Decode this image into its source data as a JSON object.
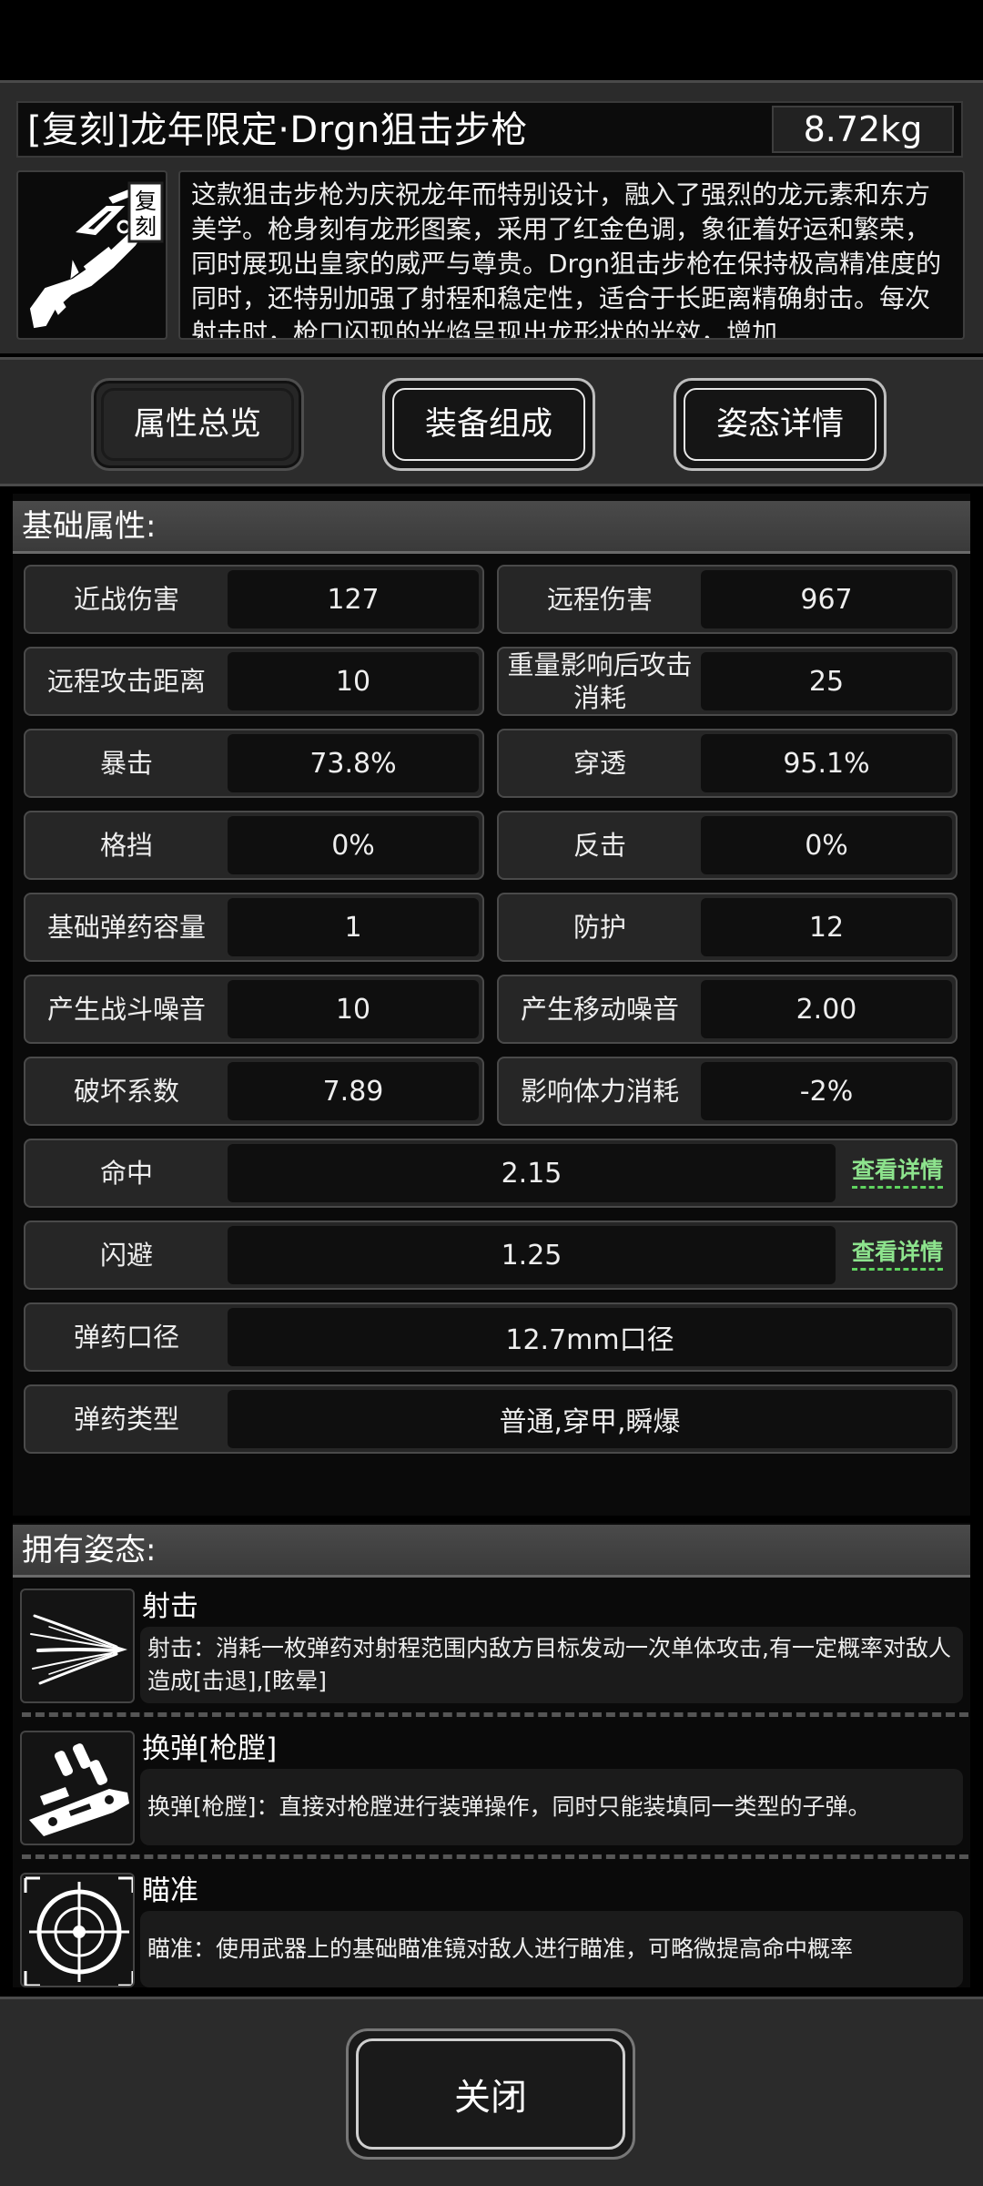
{
  "item": {
    "title": "[复刻]龙年限定·Drgn狙击步枪",
    "weight": "8.72kg",
    "image_badge": "复刻",
    "description": "这款狙击步枪为庆祝龙年而特别设计，融入了强烈的龙元素和东方美学。枪身刻有龙形图案，采用了红金色调，象征着好运和繁荣，同时展现出皇家的威严与尊贵。Drgn狙击步枪在保持极高精准度的同时，还特别加强了射程和稳定性，适合于长距离精确射击。每次射击时，枪口闪现的光焰呈现出龙形状的光效，增加"
  },
  "tabs": [
    {
      "label": "属性总览",
      "active": false
    },
    {
      "label": "装备组成",
      "active": true
    },
    {
      "label": "姿态详情",
      "active": true
    }
  ],
  "base_stats": {
    "header": "基础属性:",
    "pairs": [
      [
        {
          "label": "近战伤害",
          "value": "127"
        },
        {
          "label": "远程伤害",
          "value": "967"
        }
      ],
      [
        {
          "label": "远程攻击距离",
          "value": "10"
        },
        {
          "label": "重量影响后攻击消耗",
          "value": "25"
        }
      ],
      [
        {
          "label": "暴击",
          "value": "73.8%"
        },
        {
          "label": "穿透",
          "value": "95.1%"
        }
      ],
      [
        {
          "label": "格挡",
          "value": "0%"
        },
        {
          "label": "反击",
          "value": "0%"
        }
      ],
      [
        {
          "label": "基础弹药容量",
          "value": "1"
        },
        {
          "label": "防护",
          "value": "12"
        }
      ],
      [
        {
          "label": "产生战斗噪音",
          "value": "10"
        },
        {
          "label": "产生移动噪音",
          "value": "2.00"
        }
      ],
      [
        {
          "label": "破坏系数",
          "value": "7.89"
        },
        {
          "label": "影响体力消耗",
          "value": "-2%"
        }
      ]
    ],
    "wide": [
      {
        "label": "命中",
        "value": "2.15",
        "link": "查看详情"
      },
      {
        "label": "闪避",
        "value": "1.25",
        "link": "查看详情"
      },
      {
        "label": "弹药口径",
        "value": "12.7mm口径"
      },
      {
        "label": "弹药类型",
        "value": "普通,穿甲,瞬爆"
      }
    ]
  },
  "stances": {
    "header": "拥有姿态:",
    "items": [
      {
        "name": "射击",
        "icon": "bullet-streaks-icon",
        "desc": "射击：消耗一枚弹药对射程范围内敌方目标发动一次单体攻击,有一定概率对敌人造成[击退],[眩晕]"
      },
      {
        "name": "换弹[枪膛]",
        "icon": "reload-gun-icon",
        "desc": "换弹[枪膛]：直接对枪膛进行装弹操作，同时只能装填同一类型的子弹。"
      },
      {
        "name": "瞄准",
        "icon": "crosshair-icon",
        "desc": "瞄准：使用武器上的基础瞄准镜对敌人进行瞄准，可略微提高命中概率"
      }
    ]
  },
  "footer": {
    "close_label": "关闭"
  }
}
